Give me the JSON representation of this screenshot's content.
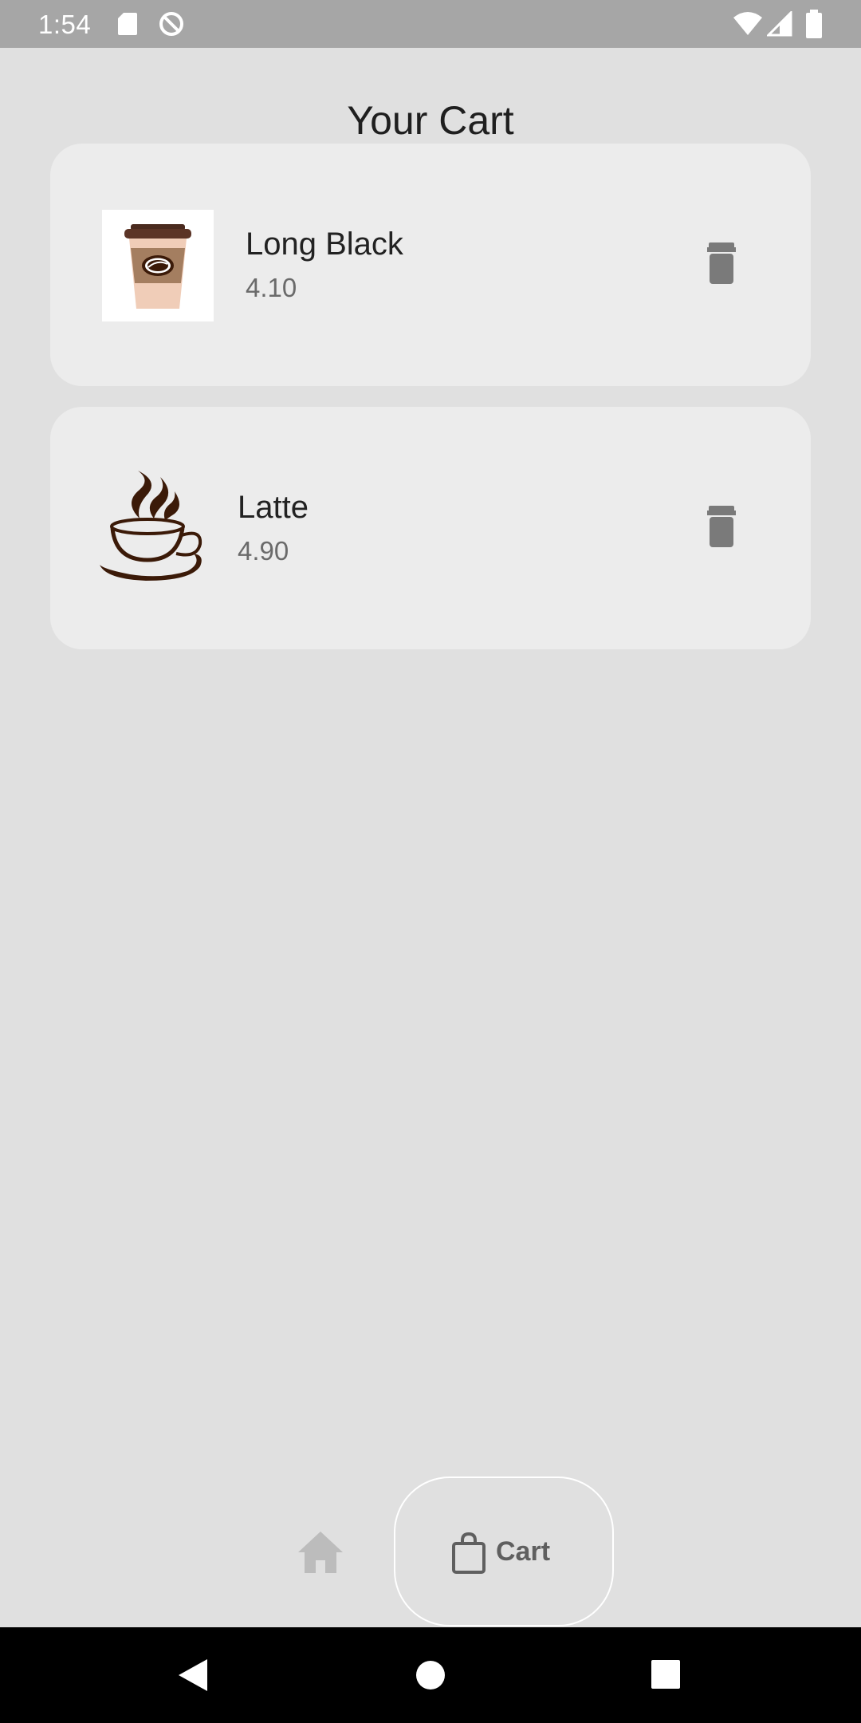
{
  "status_bar": {
    "time": "1:54",
    "icons": [
      "sd-card-icon",
      "do-not-disturb-icon",
      "wifi-icon",
      "signal-icon",
      "battery-icon"
    ]
  },
  "page": {
    "title": "Your Cart"
  },
  "cart_items": [
    {
      "name": "Long Black",
      "price": "4.10",
      "image": "takeaway-coffee-cup-icon"
    },
    {
      "name": "Latte",
      "price": "4.90",
      "image": "steaming-coffee-cup-icon"
    }
  ],
  "bottom_nav": {
    "home_icon": "home-icon",
    "cart_icon": "shopping-bag-icon",
    "cart_label": "Cart",
    "active_tab": "Cart"
  },
  "system_nav": {
    "buttons": [
      "back-icon",
      "home-circle-icon",
      "recents-square-icon"
    ]
  },
  "colors": {
    "background": "#e0e0e0",
    "card": "#ececec",
    "status_bar": "#a6a6a6",
    "icon_gray": "#7a7a7a",
    "coffee_brown": "#3b1a08"
  }
}
